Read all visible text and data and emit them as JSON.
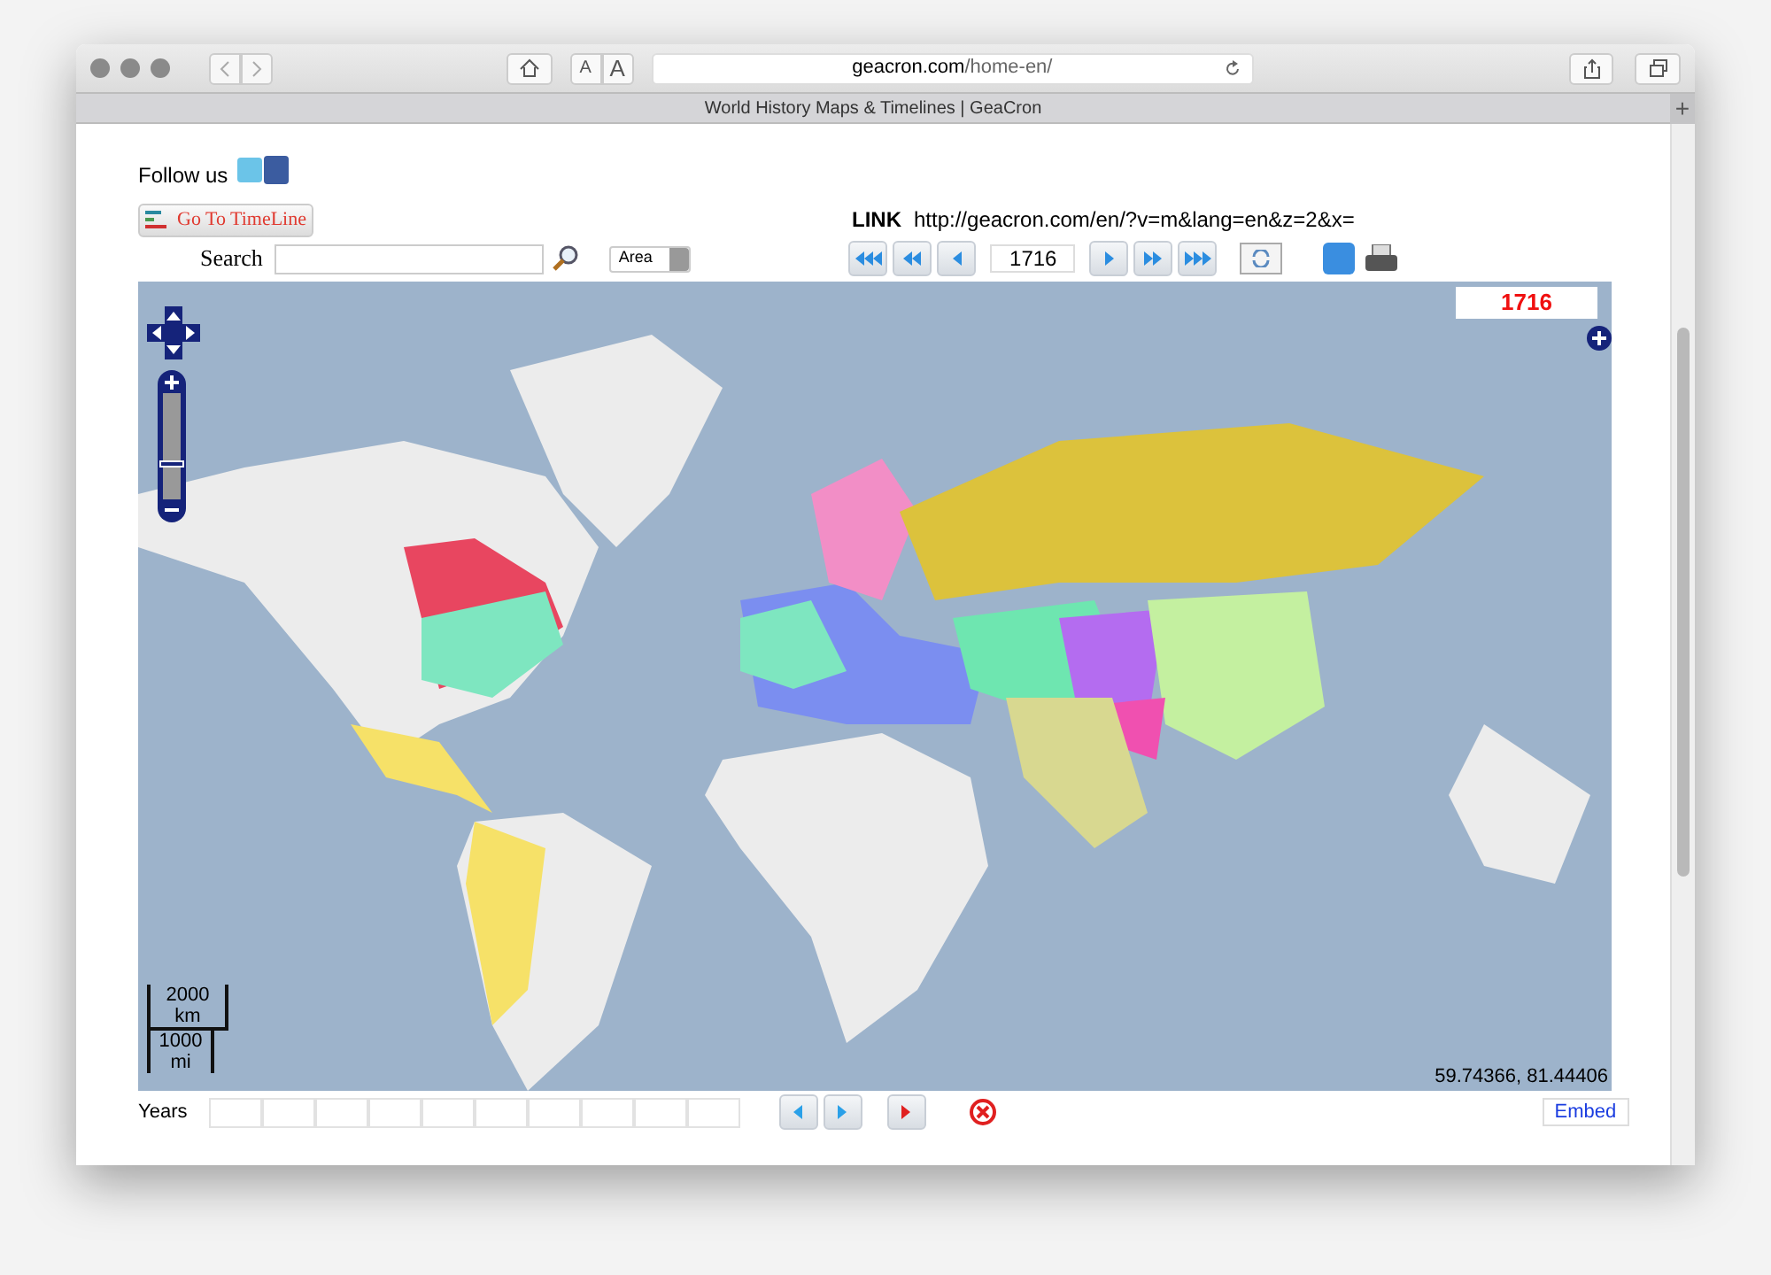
{
  "browser": {
    "domain": "geacron.com",
    "path": "/home-en/",
    "text_size_buttons": [
      "A",
      "A"
    ],
    "tab_title": "World History Maps & Timelines | GeaCron",
    "new_tab": "+"
  },
  "header": {
    "follow_label": "Follow us",
    "timeline_button": "Go To TimeLine",
    "link_label": "LINK",
    "link_url": "http://geacron.com/en/?v=m&lang=en&z=2&x=",
    "search_label": "Search",
    "area_select": "Area",
    "year_field": "1716"
  },
  "map": {
    "year_badge": "1716",
    "zoom": {
      "level": 0.33
    },
    "scale_top": "2000 km",
    "scale_bottom": "1000 mi",
    "coordinates": "59.74366, 81.44406"
  },
  "footer": {
    "years_label": "Years",
    "embed_button": "Embed"
  }
}
